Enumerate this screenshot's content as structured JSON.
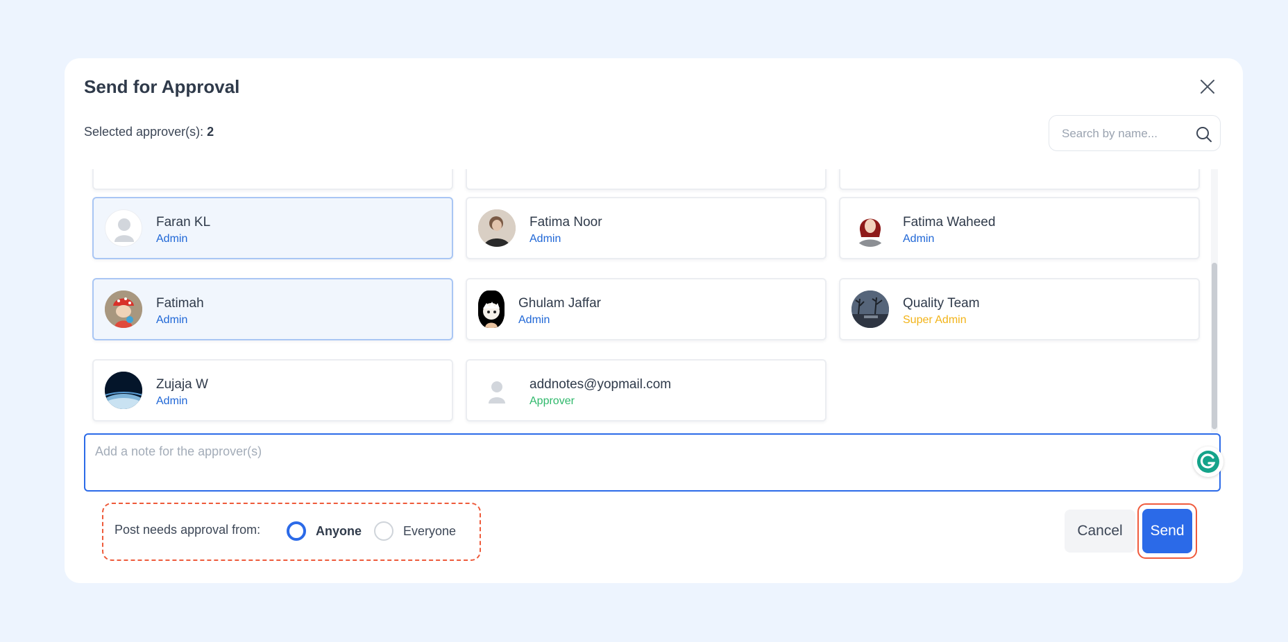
{
  "modal": {
    "title": "Send for Approval",
    "selected_label": "Selected approver(s): ",
    "selected_count": "2"
  },
  "search": {
    "placeholder": "Search by name..."
  },
  "approvers": [
    {
      "name": "Faran KL",
      "role": "Admin",
      "selected": true,
      "avatar": "default-avatar"
    },
    {
      "name": "Fatima Noor",
      "role": "Admin",
      "selected": false,
      "avatar": "photo-avatar"
    },
    {
      "name": "Fatima Waheed",
      "role": "Admin",
      "selected": false,
      "avatar": "female-avatar"
    },
    {
      "name": "Fatimah",
      "role": "Admin",
      "selected": true,
      "avatar": "cartoon-avatar"
    },
    {
      "name": "Ghulam Jaffar",
      "role": "Admin",
      "selected": false,
      "avatar": "anime-avatar"
    },
    {
      "name": "Quality Team",
      "role": "Super Admin",
      "selected": false,
      "avatar": "landscape-avatar"
    },
    {
      "name": "Zujaja W",
      "role": "Admin",
      "selected": false,
      "avatar": "earth-avatar"
    },
    {
      "name": "addnotes@yopmail.com",
      "role": "Approver",
      "selected": false,
      "avatar": "default-avatar"
    }
  ],
  "note": {
    "placeholder": "Add a note for the approver(s)"
  },
  "approval": {
    "label": "Post needs approval from:",
    "options": [
      {
        "label": "Anyone",
        "checked": true
      },
      {
        "label": "Everyone",
        "checked": false
      }
    ]
  },
  "actions": {
    "cancel": "Cancel",
    "send": "Send"
  },
  "colors": {
    "primary": "#2b6ae8",
    "admin_role": "#1e66d6",
    "super_admin_role": "#f2b318",
    "approver_role": "#2fb86b",
    "highlight": "#f05a3c"
  }
}
